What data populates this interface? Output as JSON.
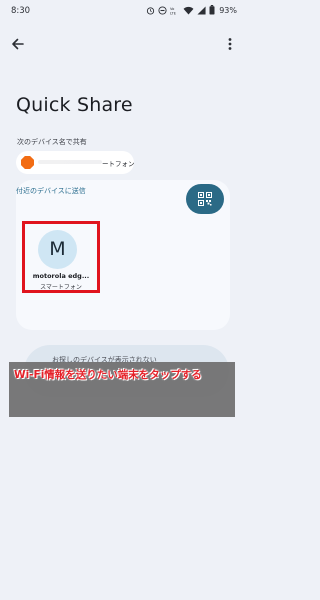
{
  "status_bar": {
    "time": "8:30",
    "battery": "93%",
    "icons": [
      "alarm-icon",
      "dnd-icon",
      "volte-icon",
      "wifi-icon",
      "signal-icon",
      "battery-icon"
    ]
  },
  "header": {
    "back_icon": "arrow-back-icon",
    "more_icon": "more-vert-icon"
  },
  "page": {
    "title": "Quick Share"
  },
  "share_as": {
    "label": "次のデバイス名で共有",
    "device_name_suffix": "ートフォン"
  },
  "nearby": {
    "link": "付近のデバイスに送信",
    "qr_icon": "qr-code-icon"
  },
  "devices": [
    {
      "initial": "M",
      "name": "motorola edg...",
      "type": "スマートフォン"
    }
  ],
  "not_found": {
    "text": "お探しのデバイスが表示されない"
  },
  "annotation": {
    "text": "Wi-Fi情報を送りたい端末をタップする"
  },
  "colors": {
    "background": "#eef1f7",
    "card": "#f7f9fd",
    "accent": "#2b6a86",
    "link": "#2a6d8e",
    "highlight": "#e0141e",
    "avatar": "#cfe6f4",
    "chip_dot": "#f26c13"
  }
}
